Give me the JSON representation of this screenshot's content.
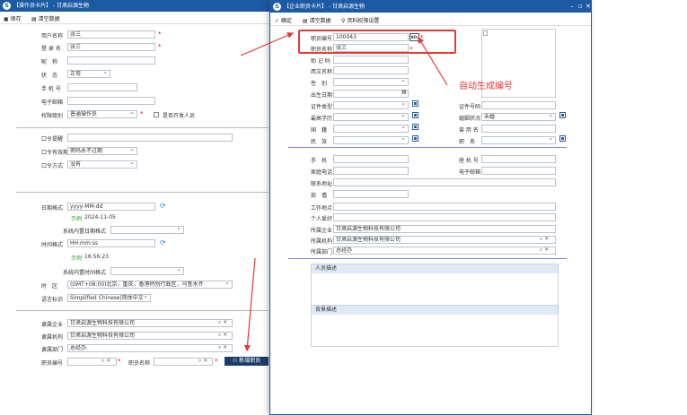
{
  "back": {
    "title": "【操作员卡片】 - 甘肃启源生物",
    "save": "保存",
    "clear": "清空数据",
    "username_label": "用户名称",
    "username": "张三",
    "login_label": "登 录 名",
    "login": "张三",
    "nickname_label": "昵　称",
    "status_label": "状　态",
    "status": "正常",
    "phone_label": "手 机 号",
    "email_label": "电子邮箱",
    "perm_label": "权限级别",
    "perm": "普通操作员",
    "dev_label": "是否开发人员",
    "pwd_hint_label": "口令提醒",
    "pwd_valid_label": "口令有效期",
    "pwd_valid": "密码永不过期",
    "pwd_mode_label": "口令方式",
    "pwd_mode": "没有",
    "date_fmt_label": "日期格式",
    "date_fmt": "yyyy-MM-dd",
    "date_example_label": "示例",
    "date_example": "2024-11-05",
    "sys_date_label": "系统内置日期格式",
    "time_fmt_label": "时间格式",
    "time_fmt": "HH:mm:ss",
    "time_example_label": "示例",
    "time_example": "16:56:23",
    "sys_time_label": "系统内置时间格式",
    "tz_label": "时　区",
    "tz": "(GMT+08:00)北京，重庆，香港特别行政区，乌鲁木齐",
    "lang_label": "语言标识",
    "lang": "Simplified Chinese|简体中文",
    "ent_label": "隶属企业",
    "ent": "甘肃启源生物科技有限公司",
    "org_label": "隶属机构",
    "org": "甘肃启源生物科技有限公司",
    "dept_label": "隶属部门",
    "dept": "总经办",
    "empno_label": "职员编号",
    "empname_label": "职员名称",
    "new_emp": "新增职员"
  },
  "front": {
    "title": "【企业职员卡片】 - 甘肃启源生物",
    "confirm": "确定",
    "clear": "清空数据",
    "perm_set": "资料权限设置",
    "empno_label": "职员编号",
    "empno": "100043",
    "no_btn": "NO.",
    "empname_label": "职员名称",
    "empname": "张三",
    "mnemonic_label": "助 记 码",
    "west_label": "西文名称",
    "gender_label": "性　别",
    "birthday_label": "出生日期",
    "idtype_label": "证件类型",
    "idno_label": "证件号码",
    "edu_label": "最高学历",
    "marital_label": "婚姻状况",
    "marital": "未婚",
    "nation_label": "国　籍",
    "usedname_label": "曾 用 名",
    "ethnic_label": "民　族",
    "post_label": "职　务",
    "mobile_label": "手　机",
    "landline_label": "座 机 号",
    "home_phone_label": "家庭电话",
    "email_label": "电子邮箱",
    "address_label": "联系地址",
    "dept2_label": "部　僖",
    "workplace_label": "工作地点",
    "hobby_label": "个人爱好",
    "ent_label": "所属企业",
    "ent": "甘肃启源生物科技有限公司",
    "org_label": "所属机构",
    "org": "甘肃启源生物科技有限公司",
    "dept_label": "所属部门",
    "dept": "总经办",
    "desc_label": "人员描述",
    "bg_label": "背景描述"
  },
  "annotation": {
    "text": "自动生成编号",
    "color": "#e53935"
  },
  "colors": {
    "titlebar": "#1c5aa3",
    "red": "#e53935"
  }
}
